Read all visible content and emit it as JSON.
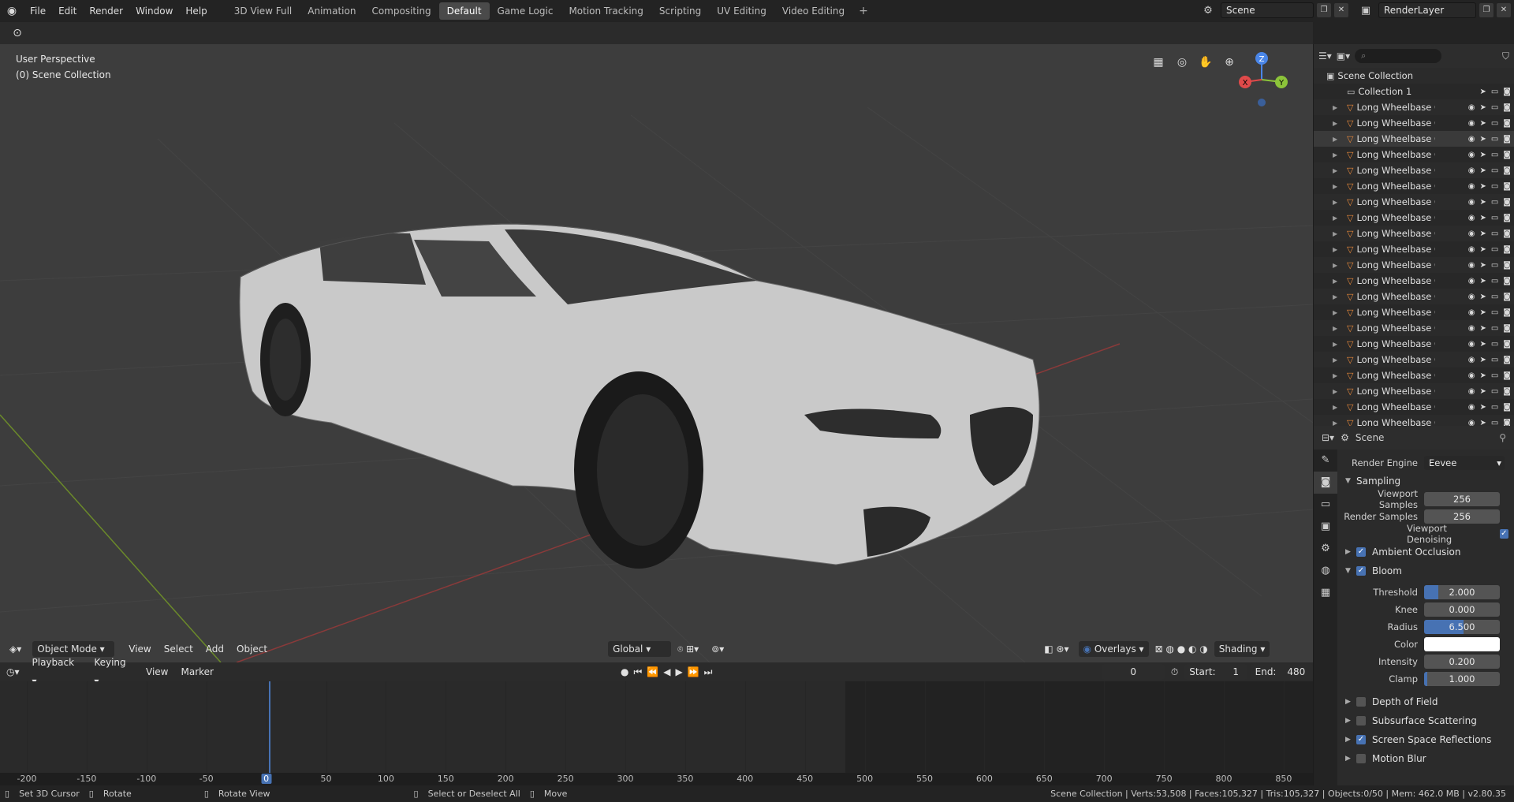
{
  "menu": [
    "File",
    "Edit",
    "Render",
    "Window",
    "Help"
  ],
  "workspaces": [
    "3D View Full",
    "Animation",
    "Compositing",
    "Default",
    "Game Logic",
    "Motion Tracking",
    "Scripting",
    "UV Editing",
    "Video Editing"
  ],
  "active_workspace": "Default",
  "scene_name": "Scene",
  "render_layer": "RenderLayer",
  "viewport": {
    "view_name": "User Perspective",
    "collection_label": "(0) Scene Collection",
    "gizmo": {
      "x": "X",
      "y": "Y",
      "z": "Z"
    }
  },
  "viewport_header": {
    "mode": "Object Mode",
    "menus": [
      "View",
      "Select",
      "Add",
      "Object"
    ],
    "transform": "Global",
    "overlays": "Overlays",
    "shading": "Shading"
  },
  "timeline": {
    "menus": [
      "Playback",
      "Keying",
      "View",
      "Marker"
    ],
    "current_frame": "0",
    "start_label": "Start:",
    "start": "1",
    "end_label": "End:",
    "end": "480",
    "ticks": [
      "-200",
      "-150",
      "-100",
      "-50",
      "0",
      "50",
      "100",
      "150",
      "200",
      "250",
      "300",
      "350",
      "400",
      "450",
      "500",
      "550",
      "600",
      "650",
      "700",
      "750",
      "800",
      "850"
    ]
  },
  "statusbar": {
    "set_cursor": "Set 3D Cursor",
    "rotate": "Rotate",
    "rotate_view": "Rotate View",
    "select": "Select or Deselect All",
    "move": "Move",
    "info": "Scene Collection | Verts:53,508 | Faces:105,327 | Tris:105,327 | Objects:0/50 | Mem: 462.0 MB | v2.80.35"
  },
  "outliner": {
    "root": "Scene Collection",
    "collection": "Collection 1",
    "object_name": "Long Wheelbase Car",
    "object_count": 21
  },
  "properties": {
    "context": "Scene",
    "render_engine_label": "Render Engine",
    "render_engine": "Eevee",
    "sampling": "Sampling",
    "viewport_samples_label": "Viewport Samples",
    "viewport_samples": "256",
    "render_samples_label": "Render Samples",
    "render_samples": "256",
    "denoising_label": "Viewport Denoising",
    "ambient_occlusion": "Ambient Occlusion",
    "bloom": "Bloom",
    "threshold_label": "Threshold",
    "threshold": "2.000",
    "knee_label": "Knee",
    "knee": "0.000",
    "radius_label": "Radius",
    "radius": "6.500",
    "color_label": "Color",
    "intensity_label": "Intensity",
    "intensity": "0.200",
    "clamp_label": "Clamp",
    "clamp": "1.000",
    "depth_of_field": "Depth of Field",
    "subsurface": "Subsurface Scattering",
    "ssr": "Screen Space Reflections",
    "motion_blur": "Motion Blur"
  },
  "colors": {
    "accent": "#4772b3",
    "viewport_bg": "#3d3d3d",
    "object_icon": "#e8883a"
  }
}
